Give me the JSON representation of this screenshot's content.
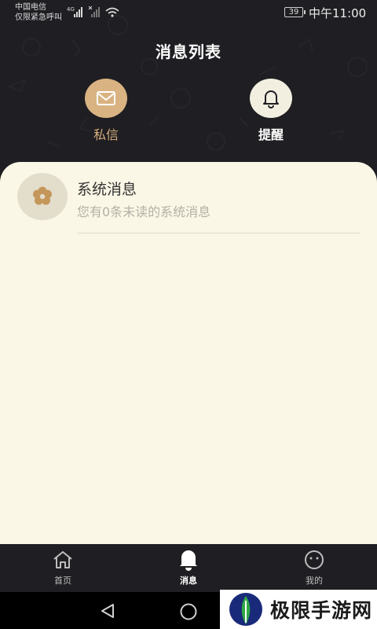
{
  "status_bar": {
    "carrier_line1": "中国电信",
    "carrier_line2": "仅限紧急呼叫",
    "network": "4G",
    "battery": "39",
    "time": "中午11:00"
  },
  "header": {
    "title": "消息列表",
    "tabs": [
      {
        "label": "私信",
        "icon": "mail-icon"
      },
      {
        "label": "提醒",
        "icon": "bell-icon"
      }
    ]
  },
  "messages": [
    {
      "title": "系统消息",
      "subtitle": "您有0条未读的系统消息",
      "icon": "flower-icon"
    }
  ],
  "bottom_nav": {
    "items": [
      {
        "label": "首页",
        "icon": "home-icon"
      },
      {
        "label": "消息",
        "icon": "bell-icon",
        "active": true
      },
      {
        "label": "我的",
        "icon": "smiley-icon"
      }
    ]
  },
  "watermark": {
    "text": "极限手游网"
  },
  "colors": {
    "background_dark": "#1f1e22",
    "card": "#fbf7e6",
    "accent_gold": "#d9b382",
    "remind_circle": "#f3efe0"
  }
}
